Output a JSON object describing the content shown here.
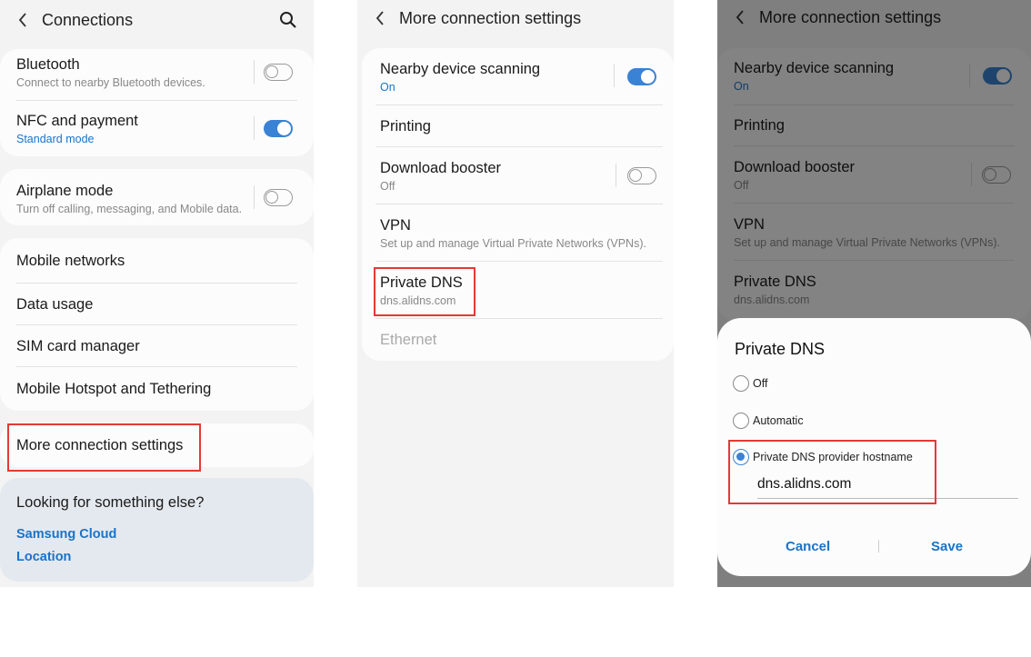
{
  "panel1": {
    "header": {
      "title": "Connections"
    },
    "bluetooth": {
      "label": "Bluetooth",
      "sub": "Connect to nearby Bluetooth devices."
    },
    "nfc": {
      "label": "NFC and payment",
      "sub": "Standard mode"
    },
    "airplane": {
      "label": "Airplane mode",
      "sub": "Turn off calling, messaging, and Mobile data."
    },
    "mobile_networks": "Mobile networks",
    "data_usage": "Data usage",
    "sim_manager": "SIM card manager",
    "hotspot": "Mobile Hotspot and Tethering",
    "more_settings": "More connection settings",
    "looking": {
      "title": "Looking for something else?",
      "links": [
        "Samsung Cloud",
        "Location"
      ]
    }
  },
  "panel2": {
    "header": {
      "title": "More connection settings"
    },
    "nearby": {
      "label": "Nearby device scanning",
      "sub": "On"
    },
    "printing": "Printing",
    "download_booster": {
      "label": "Download booster",
      "sub": "Off"
    },
    "vpn": {
      "label": "VPN",
      "sub": "Set up and manage Virtual Private Networks (VPNs)."
    },
    "private_dns": {
      "label": "Private DNS",
      "sub": "dns.alidns.com"
    },
    "ethernet": "Ethernet"
  },
  "panel3": {
    "header": {
      "title": "More connection settings"
    },
    "nearby": {
      "label": "Nearby device scanning",
      "sub": "On"
    },
    "printing": "Printing",
    "download_booster": {
      "label": "Download booster",
      "sub": "Off"
    },
    "vpn": {
      "label": "VPN",
      "sub": "Set up and manage Virtual Private Networks (VPNs)."
    },
    "private_dns": {
      "label": "Private DNS",
      "sub": "dns.alidns.com"
    },
    "dialog": {
      "title": "Private DNS",
      "options": [
        "Off",
        "Automatic",
        "Private DNS provider hostname"
      ],
      "selected": "Private DNS provider hostname",
      "hostname": "dns.alidns.com",
      "cancel": "Cancel",
      "save": "Save"
    }
  },
  "colors": {
    "accent": "#1a73c8",
    "toggle_on": "#3a82d4",
    "highlight": "#e53935",
    "panel_bg": "#f3f3f3"
  },
  "icons": {
    "back": "chevron-left-icon",
    "search": "search-icon"
  }
}
